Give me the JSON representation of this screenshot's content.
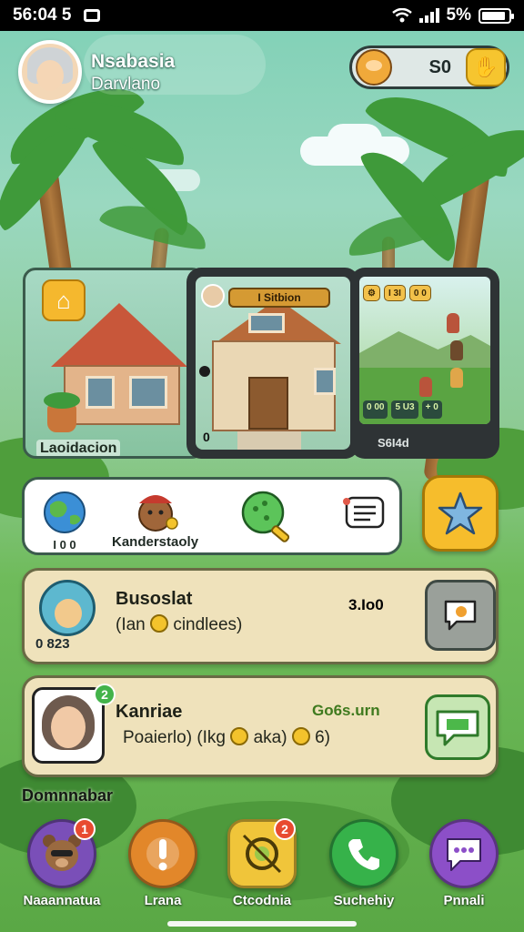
{
  "status_bar": {
    "time": "56:04 5",
    "battery": "5%",
    "battery_level": 0.9,
    "icons": [
      "photo-icon",
      "wifi-icon",
      "signal-icon",
      "battery-icon"
    ]
  },
  "header": {
    "username": "Nsabasia",
    "subtitle": "Darvlano",
    "avatar_icon": "profile-avatar",
    "currency": {
      "icon": "monkey-icon",
      "value": "S0",
      "add_icon": "hand-icon"
    }
  },
  "preview": {
    "home_icon": "home-icon",
    "location_label": "Laoidacion",
    "phone_a": {
      "label": "I Sitbion",
      "counter": "0"
    },
    "phone_b": {
      "chips": [
        "⚙",
        "I 3I",
        "0 0"
      ],
      "bottom_chips": [
        "0 00",
        "5 U3",
        "+ 0"
      ],
      "timer": "S6I4d"
    }
  },
  "categories": {
    "items": [
      {
        "icon": "globe-icon",
        "label": "I 0  0",
        "color": "#3b8fd6"
      },
      {
        "icon": "character-icon",
        "label": "Kanderstaoly",
        "color": "#a94a2e"
      },
      {
        "icon": "magnifier-icon",
        "label": "",
        "color": "#5cc45a"
      },
      {
        "icon": "list-icon",
        "label": "",
        "color": "#e15a4a"
      }
    ],
    "star_icon": "star-icon"
  },
  "list": [
    {
      "title": "Busoslat",
      "subtitle": "(Ian",
      "subtitle_tail": "cindlees)",
      "right": "3.Io0",
      "avatar_badge": "0 823",
      "action_icon": "chat-bubble-icon",
      "right_color": "#6b4f1c"
    },
    {
      "title": "Kanriae",
      "subtitle": "Poaierlo) (Ikg",
      "subtitle_mid": "aka)",
      "subtitle_tail": "6)",
      "right": "Go6s.urn",
      "badge": "2",
      "action_icon": "message-icon",
      "right_color": "#3f7a1e"
    }
  ],
  "section_title": "Domnnabar",
  "nav": [
    {
      "label": "Naaannatua",
      "icon": "bear-icon",
      "badge": "1",
      "color": "#7a4fb8"
    },
    {
      "label": "Lrana",
      "icon": "alert-icon",
      "badge": "",
      "color": "#e2872a"
    },
    {
      "label": "Ctcodnia",
      "icon": "target-icon",
      "badge": "2",
      "color": "#f0c53a"
    },
    {
      "label": "Suchehiy",
      "icon": "phone-icon",
      "badge": "",
      "color": "#36b24a"
    },
    {
      "label": "Pnnali",
      "icon": "chat-icon",
      "badge": "",
      "color": "#8c4fc8"
    }
  ]
}
